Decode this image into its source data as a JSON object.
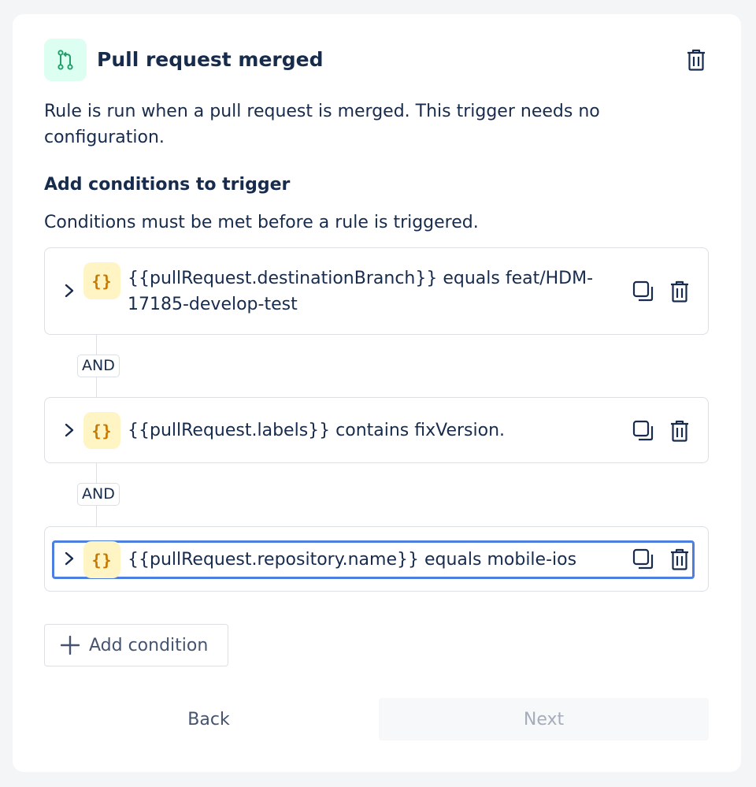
{
  "trigger": {
    "icon": "pull-request-icon",
    "title": "Pull request merged",
    "description": "Rule is run when a pull request is merged. This trigger needs no configuration."
  },
  "conditions_section": {
    "title": "Add conditions to trigger",
    "subtitle": "Conditions must be met before a rule is triggered."
  },
  "conditions": [
    {
      "icon": "smart-value-icon",
      "glyph": "{}",
      "text": "{{pullRequest.destinationBranch}} equals feat/HDM-17185-develop-test"
    },
    {
      "icon": "smart-value-icon",
      "glyph": "{}",
      "text": "{{pullRequest.labels}} contains fixVersion."
    },
    {
      "icon": "smart-value-icon",
      "glyph": "{}",
      "text": "{{pullRequest.repository.name}} equals mobile-ios"
    }
  ],
  "connectors": [
    "AND",
    "AND"
  ],
  "add_condition_label": "Add condition",
  "footer": {
    "back_label": "Back",
    "next_label": "Next",
    "next_enabled": false
  },
  "colors": {
    "trigger_icon_bg": "#dcfff1",
    "trigger_icon_fg": "#22a06b",
    "brace_bg": "#fff4c4",
    "brace_fg": "#c77800",
    "focus_border": "#4c7fe0"
  }
}
